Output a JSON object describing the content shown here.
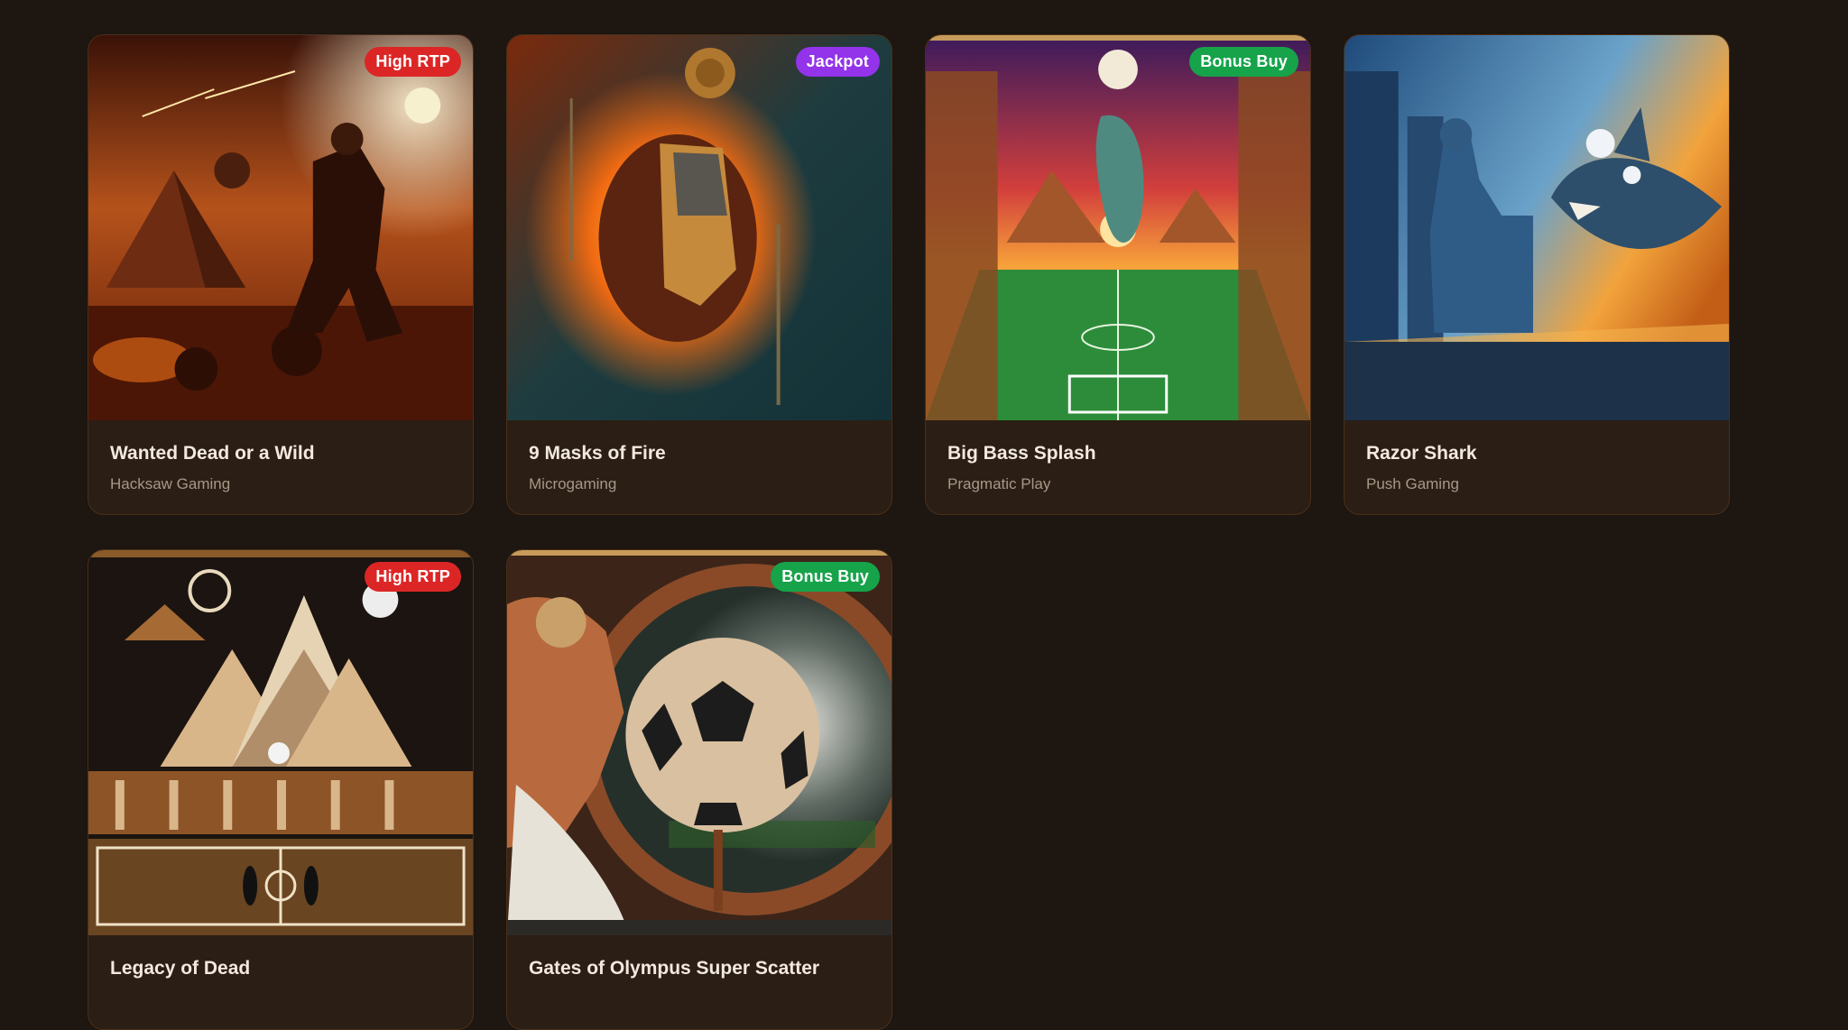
{
  "games": [
    {
      "title": "Wanted Dead or a Wild",
      "provider": "Hacksaw Gaming",
      "badge": "High RTP",
      "badge_color": "#dc2626",
      "art": "pharaoh-warrior-desert"
    },
    {
      "title": "9 Masks of Fire",
      "provider": "Microgaming",
      "badge": "Jackpot",
      "badge_color": "#9333ea",
      "art": "flaming-pharaoh-mask"
    },
    {
      "title": "Big Bass Splash",
      "provider": "Pragmatic Play",
      "badge": "Bonus Buy",
      "badge_color": "#16a34a",
      "art": "fish-football-pitch"
    },
    {
      "title": "Razor Shark",
      "provider": "Push Gaming",
      "badge": "",
      "badge_color": "",
      "art": "shark-pharaoh-statue"
    },
    {
      "title": "Legacy of Dead",
      "provider": "",
      "badge": "High RTP",
      "badge_color": "#dc2626",
      "art": "pyramids-hieroglyph-field"
    },
    {
      "title": "Gates of Olympus Super Scatter",
      "provider": "",
      "badge": "Bonus Buy",
      "badge_color": "#16a34a",
      "art": "egyptian-soccer-ball"
    }
  ]
}
